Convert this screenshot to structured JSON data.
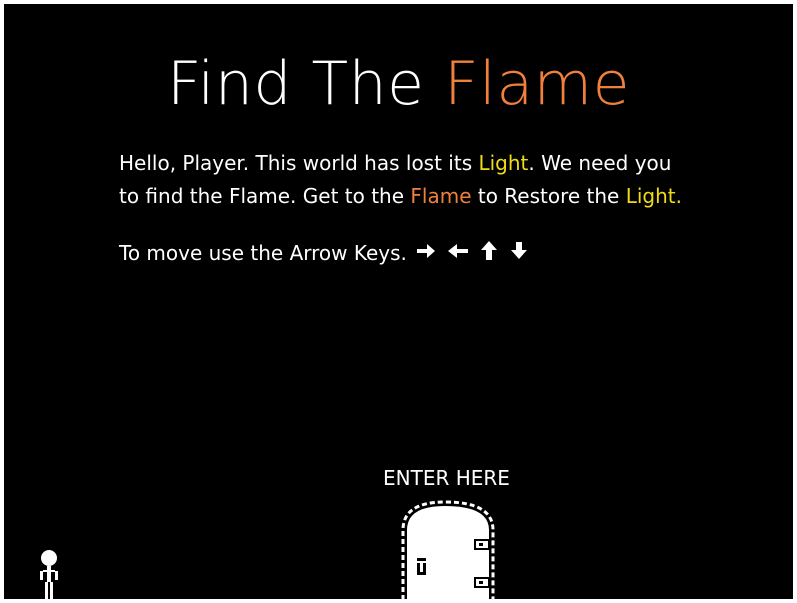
{
  "game": {
    "title_part1": "Find The ",
    "title_part2": "Flame",
    "intro": {
      "line1_a": "Hello, Player. This world has lost its ",
      "line1_b": "Light",
      "line1_c": ". We need you",
      "line2_a": "to find the Flame. Get to the ",
      "line2_b": "Flame",
      "line2_c": " to Restore the ",
      "line2_d": "Light."
    },
    "controls_text": "To move use the Arrow Keys.",
    "arrow_icons": [
      "arrow-right-icon",
      "arrow-left-icon",
      "arrow-up-icon",
      "arrow-down-icon"
    ],
    "door_label": "ENTER HERE"
  },
  "colors": {
    "background": "#000000",
    "text": "#ffffff",
    "flame_accent": "#f0803c",
    "light_accent": "#f0dc14"
  }
}
